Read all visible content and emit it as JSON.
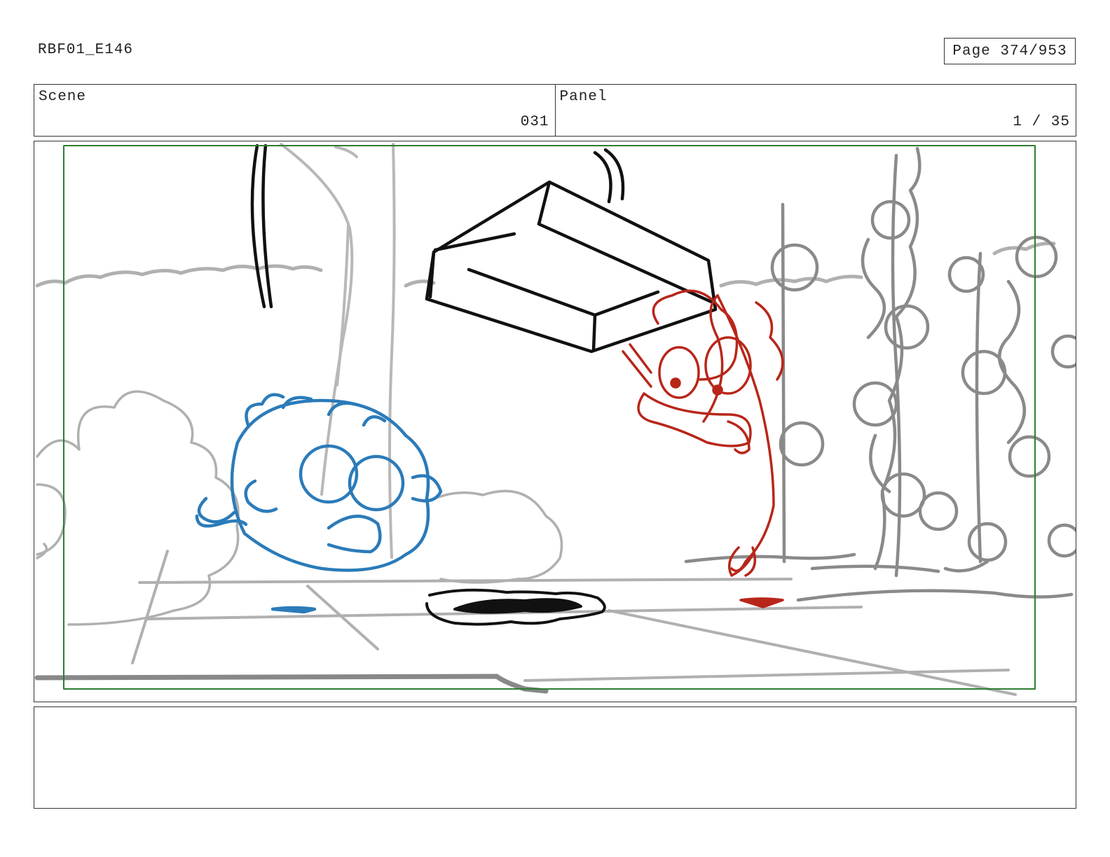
{
  "header": {
    "document_code": "RBF01_E146",
    "page_indicator": "Page 374/953"
  },
  "scene": {
    "label": "Scene",
    "value": "031"
  },
  "panel": {
    "label": "Panel",
    "value": "1 / 35"
  },
  "colors": {
    "safe_frame": "#2e7d32",
    "background_sketch": "#b0b0b0",
    "foreground_sketch": "#7a7a7a",
    "blue_character": "#2b7bb9",
    "red_character": "#b8261a",
    "prop_ink": "#111111"
  },
  "drawing": {
    "elements": [
      "tree-trunk",
      "bushes",
      "hedge-line",
      "tomato-vines",
      "falling-box",
      "blue-character",
      "red-character",
      "ground-shadow"
    ]
  },
  "notes": {
    "text": ""
  }
}
